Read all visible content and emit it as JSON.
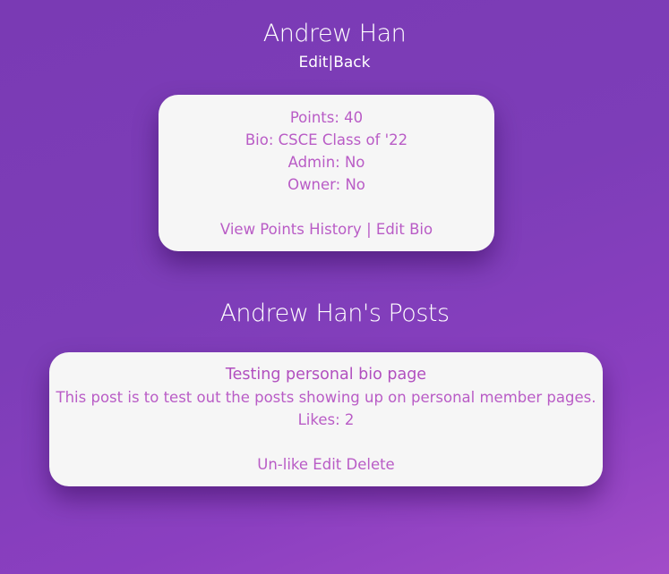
{
  "profile": {
    "name": "Andrew Han",
    "links": {
      "edit": "Edit",
      "separator": "|",
      "back": "Back"
    },
    "card": {
      "points": "Points: 40",
      "bio": "Bio: CSCE Class of '22",
      "admin": "Admin: No",
      "owner": "Owner: No",
      "view_points_history": "View Points History",
      "separator": "|",
      "edit_bio": "Edit Bio"
    }
  },
  "posts": {
    "heading": "Andrew Han's Posts",
    "items": [
      {
        "title": "Testing personal bio page",
        "body": "This post is to test out the posts showing up on personal member pages.",
        "likes": "Likes: 2",
        "actions": {
          "unlike": "Un-like",
          "edit": "Edit",
          "delete": "Delete"
        }
      }
    ]
  },
  "colors": {
    "background_start": "#7a3ab4",
    "background_end": "#a24cc8",
    "card_background": "#f6f6f6",
    "card_text": "#b95cc6"
  }
}
